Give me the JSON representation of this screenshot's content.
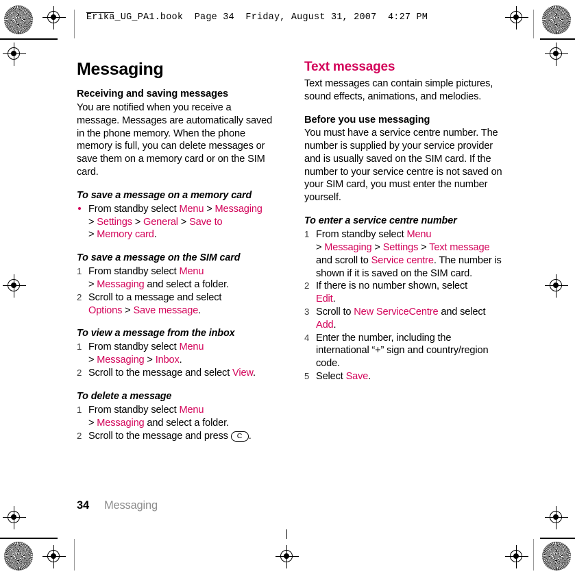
{
  "header": {
    "slug": "Erika_UG_PA1.book  Page 34  Friday, August 31, 2007  4:27 PM"
  },
  "colors": {
    "accent_pink": "#D3045A",
    "body_text": "#000000",
    "footer_title": "#8d8d8d"
  },
  "left_column": {
    "chapter_title": "Messaging",
    "sections": [
      {
        "subhead": "Receiving and saving messages",
        "body": "You are notified when you receive a message. Messages are automatically saved in the phone memory. When the phone memory is full, you can delete messages or save them on a memory card or on the SIM card."
      }
    ],
    "procedures": [
      {
        "title": "To save a message on a memory card",
        "list_type": "bullet",
        "steps": [
          {
            "parts": [
              {
                "t": "From standby select ",
                "style": "plain"
              },
              {
                "t": "Menu",
                "style": "ui"
              },
              {
                "t": " > ",
                "style": "plain"
              },
              {
                "t": "Messaging",
                "style": "ui"
              },
              {
                "t": "\n> ",
                "style": "plain"
              },
              {
                "t": "Settings",
                "style": "ui"
              },
              {
                "t": " > ",
                "style": "plain"
              },
              {
                "t": "General",
                "style": "ui"
              },
              {
                "t": " > ",
                "style": "plain"
              },
              {
                "t": "Save to",
                "style": "ui"
              },
              {
                "t": "\n> ",
                "style": "plain"
              },
              {
                "t": "Memory card",
                "style": "ui"
              },
              {
                "t": ".",
                "style": "plain"
              }
            ]
          }
        ]
      },
      {
        "title": "To save a message on the SIM card",
        "list_type": "number",
        "steps": [
          {
            "num": "1",
            "parts": [
              {
                "t": "From standby select ",
                "style": "plain"
              },
              {
                "t": "Menu",
                "style": "ui"
              },
              {
                "t": "\n>  ",
                "style": "plain"
              },
              {
                "t": "Messaging",
                "style": "ui"
              },
              {
                "t": " and select a folder.",
                "style": "plain"
              }
            ]
          },
          {
            "num": "2",
            "parts": [
              {
                "t": "Scroll to a message and select\n",
                "style": "plain"
              },
              {
                "t": "Options",
                "style": "ui"
              },
              {
                "t": " > ",
                "style": "plain"
              },
              {
                "t": "Save message",
                "style": "ui"
              },
              {
                "t": ".",
                "style": "plain"
              }
            ]
          }
        ]
      },
      {
        "title": "To view a message from the inbox",
        "list_type": "number",
        "steps": [
          {
            "num": "1",
            "parts": [
              {
                "t": "From standby select ",
                "style": "plain"
              },
              {
                "t": "Menu",
                "style": "ui"
              },
              {
                "t": "\n>  ",
                "style": "plain"
              },
              {
                "t": "Messaging",
                "style": "ui"
              },
              {
                "t": " > ",
                "style": "plain"
              },
              {
                "t": "Inbox",
                "style": "ui"
              },
              {
                "t": ".",
                "style": "plain"
              }
            ]
          },
          {
            "num": "2",
            "parts": [
              {
                "t": "Scroll to the message and select ",
                "style": "plain"
              },
              {
                "t": "View",
                "style": "ui"
              },
              {
                "t": ".",
                "style": "plain"
              }
            ]
          }
        ]
      },
      {
        "title": "To delete a message",
        "list_type": "number",
        "steps": [
          {
            "num": "1",
            "parts": [
              {
                "t": "From standby select ",
                "style": "plain"
              },
              {
                "t": "Menu",
                "style": "ui"
              },
              {
                "t": "\n> ",
                "style": "plain"
              },
              {
                "t": "Messaging",
                "style": "ui"
              },
              {
                "t": " and select a folder.",
                "style": "plain"
              }
            ]
          },
          {
            "num": "2",
            "parts": [
              {
                "t": "Scroll to the message and press ",
                "style": "plain"
              },
              {
                "t": "C",
                "style": "keycap"
              },
              {
                "t": ".",
                "style": "plain"
              }
            ]
          }
        ]
      }
    ]
  },
  "right_column": {
    "section_title": "Text messages",
    "intro": "Text messages can contain simple pictures, sound effects, animations, and melodies.",
    "sections": [
      {
        "subhead": "Before you use messaging",
        "body": "You must have a service centre number. The number is supplied by your service provider and is usually saved on the SIM card. If the number to your service centre is not saved on your SIM card, you must enter the number yourself."
      }
    ],
    "procedures": [
      {
        "title": "To enter a service centre number",
        "list_type": "number",
        "steps": [
          {
            "num": "1",
            "parts": [
              {
                "t": "From standby select ",
                "style": "plain"
              },
              {
                "t": "Menu",
                "style": "ui"
              },
              {
                "t": "\n>  ",
                "style": "plain"
              },
              {
                "t": "Messaging",
                "style": "ui"
              },
              {
                "t": " > ",
                "style": "plain"
              },
              {
                "t": "Settings",
                "style": "ui"
              },
              {
                "t": " > ",
                "style": "plain"
              },
              {
                "t": "Text message",
                "style": "ui"
              },
              {
                "t": " and scroll to ",
                "style": "plain"
              },
              {
                "t": "Service centre",
                "style": "ui"
              },
              {
                "t": ". The number is shown if it is saved on the SIM card.",
                "style": "plain"
              }
            ]
          },
          {
            "num": "2",
            "parts": [
              {
                "t": "If there is no number shown, select\n",
                "style": "plain"
              },
              {
                "t": "Edit",
                "style": "ui"
              },
              {
                "t": ".",
                "style": "plain"
              }
            ]
          },
          {
            "num": "3",
            "parts": [
              {
                "t": "Scroll to ",
                "style": "plain"
              },
              {
                "t": "New ServiceCentre",
                "style": "ui"
              },
              {
                "t": " and select\n",
                "style": "plain"
              },
              {
                "t": "Add",
                "style": "ui"
              },
              {
                "t": ".",
                "style": "plain"
              }
            ]
          },
          {
            "num": "4",
            "parts": [
              {
                "t": "Enter the number, including the international “+” sign and country/region code.",
                "style": "plain"
              }
            ]
          },
          {
            "num": "5",
            "parts": [
              {
                "t": "Select ",
                "style": "plain"
              },
              {
                "t": "Save",
                "style": "ui"
              },
              {
                "t": ".",
                "style": "plain"
              }
            ]
          }
        ]
      }
    ]
  },
  "footer": {
    "page_number": "34",
    "chapter": "Messaging"
  }
}
